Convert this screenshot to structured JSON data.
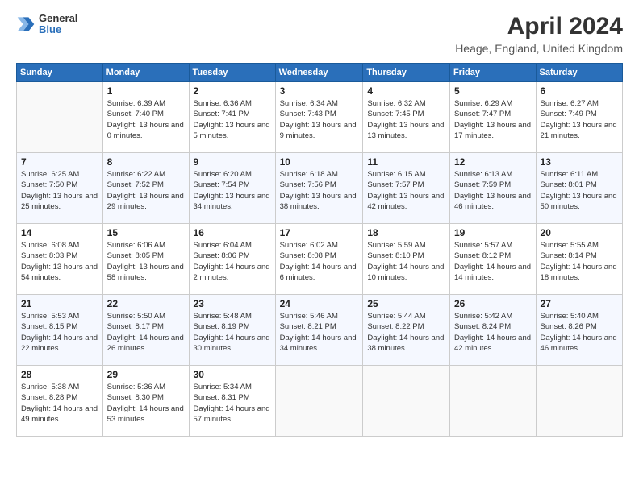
{
  "header": {
    "logo": {
      "general": "General",
      "blue": "Blue"
    },
    "title": "April 2024",
    "location": "Heage, England, United Kingdom"
  },
  "weekdays": [
    "Sunday",
    "Monday",
    "Tuesday",
    "Wednesday",
    "Thursday",
    "Friday",
    "Saturday"
  ],
  "weeks": [
    [
      {
        "day": "",
        "empty": true
      },
      {
        "day": "1",
        "sunrise": "Sunrise: 6:39 AM",
        "sunset": "Sunset: 7:40 PM",
        "daylight": "Daylight: 13 hours and 0 minutes."
      },
      {
        "day": "2",
        "sunrise": "Sunrise: 6:36 AM",
        "sunset": "Sunset: 7:41 PM",
        "daylight": "Daylight: 13 hours and 5 minutes."
      },
      {
        "day": "3",
        "sunrise": "Sunrise: 6:34 AM",
        "sunset": "Sunset: 7:43 PM",
        "daylight": "Daylight: 13 hours and 9 minutes."
      },
      {
        "day": "4",
        "sunrise": "Sunrise: 6:32 AM",
        "sunset": "Sunset: 7:45 PM",
        "daylight": "Daylight: 13 hours and 13 minutes."
      },
      {
        "day": "5",
        "sunrise": "Sunrise: 6:29 AM",
        "sunset": "Sunset: 7:47 PM",
        "daylight": "Daylight: 13 hours and 17 minutes."
      },
      {
        "day": "6",
        "sunrise": "Sunrise: 6:27 AM",
        "sunset": "Sunset: 7:49 PM",
        "daylight": "Daylight: 13 hours and 21 minutes."
      }
    ],
    [
      {
        "day": "7",
        "sunrise": "Sunrise: 6:25 AM",
        "sunset": "Sunset: 7:50 PM",
        "daylight": "Daylight: 13 hours and 25 minutes."
      },
      {
        "day": "8",
        "sunrise": "Sunrise: 6:22 AM",
        "sunset": "Sunset: 7:52 PM",
        "daylight": "Daylight: 13 hours and 29 minutes."
      },
      {
        "day": "9",
        "sunrise": "Sunrise: 6:20 AM",
        "sunset": "Sunset: 7:54 PM",
        "daylight": "Daylight: 13 hours and 34 minutes."
      },
      {
        "day": "10",
        "sunrise": "Sunrise: 6:18 AM",
        "sunset": "Sunset: 7:56 PM",
        "daylight": "Daylight: 13 hours and 38 minutes."
      },
      {
        "day": "11",
        "sunrise": "Sunrise: 6:15 AM",
        "sunset": "Sunset: 7:57 PM",
        "daylight": "Daylight: 13 hours and 42 minutes."
      },
      {
        "day": "12",
        "sunrise": "Sunrise: 6:13 AM",
        "sunset": "Sunset: 7:59 PM",
        "daylight": "Daylight: 13 hours and 46 minutes."
      },
      {
        "day": "13",
        "sunrise": "Sunrise: 6:11 AM",
        "sunset": "Sunset: 8:01 PM",
        "daylight": "Daylight: 13 hours and 50 minutes."
      }
    ],
    [
      {
        "day": "14",
        "sunrise": "Sunrise: 6:08 AM",
        "sunset": "Sunset: 8:03 PM",
        "daylight": "Daylight: 13 hours and 54 minutes."
      },
      {
        "day": "15",
        "sunrise": "Sunrise: 6:06 AM",
        "sunset": "Sunset: 8:05 PM",
        "daylight": "Daylight: 13 hours and 58 minutes."
      },
      {
        "day": "16",
        "sunrise": "Sunrise: 6:04 AM",
        "sunset": "Sunset: 8:06 PM",
        "daylight": "Daylight: 14 hours and 2 minutes."
      },
      {
        "day": "17",
        "sunrise": "Sunrise: 6:02 AM",
        "sunset": "Sunset: 8:08 PM",
        "daylight": "Daylight: 14 hours and 6 minutes."
      },
      {
        "day": "18",
        "sunrise": "Sunrise: 5:59 AM",
        "sunset": "Sunset: 8:10 PM",
        "daylight": "Daylight: 14 hours and 10 minutes."
      },
      {
        "day": "19",
        "sunrise": "Sunrise: 5:57 AM",
        "sunset": "Sunset: 8:12 PM",
        "daylight": "Daylight: 14 hours and 14 minutes."
      },
      {
        "day": "20",
        "sunrise": "Sunrise: 5:55 AM",
        "sunset": "Sunset: 8:14 PM",
        "daylight": "Daylight: 14 hours and 18 minutes."
      }
    ],
    [
      {
        "day": "21",
        "sunrise": "Sunrise: 5:53 AM",
        "sunset": "Sunset: 8:15 PM",
        "daylight": "Daylight: 14 hours and 22 minutes."
      },
      {
        "day": "22",
        "sunrise": "Sunrise: 5:50 AM",
        "sunset": "Sunset: 8:17 PM",
        "daylight": "Daylight: 14 hours and 26 minutes."
      },
      {
        "day": "23",
        "sunrise": "Sunrise: 5:48 AM",
        "sunset": "Sunset: 8:19 PM",
        "daylight": "Daylight: 14 hours and 30 minutes."
      },
      {
        "day": "24",
        "sunrise": "Sunrise: 5:46 AM",
        "sunset": "Sunset: 8:21 PM",
        "daylight": "Daylight: 14 hours and 34 minutes."
      },
      {
        "day": "25",
        "sunrise": "Sunrise: 5:44 AM",
        "sunset": "Sunset: 8:22 PM",
        "daylight": "Daylight: 14 hours and 38 minutes."
      },
      {
        "day": "26",
        "sunrise": "Sunrise: 5:42 AM",
        "sunset": "Sunset: 8:24 PM",
        "daylight": "Daylight: 14 hours and 42 minutes."
      },
      {
        "day": "27",
        "sunrise": "Sunrise: 5:40 AM",
        "sunset": "Sunset: 8:26 PM",
        "daylight": "Daylight: 14 hours and 46 minutes."
      }
    ],
    [
      {
        "day": "28",
        "sunrise": "Sunrise: 5:38 AM",
        "sunset": "Sunset: 8:28 PM",
        "daylight": "Daylight: 14 hours and 49 minutes."
      },
      {
        "day": "29",
        "sunrise": "Sunrise: 5:36 AM",
        "sunset": "Sunset: 8:30 PM",
        "daylight": "Daylight: 14 hours and 53 minutes."
      },
      {
        "day": "30",
        "sunrise": "Sunrise: 5:34 AM",
        "sunset": "Sunset: 8:31 PM",
        "daylight": "Daylight: 14 hours and 57 minutes."
      },
      {
        "day": "",
        "empty": true
      },
      {
        "day": "",
        "empty": true
      },
      {
        "day": "",
        "empty": true
      },
      {
        "day": "",
        "empty": true
      }
    ]
  ]
}
